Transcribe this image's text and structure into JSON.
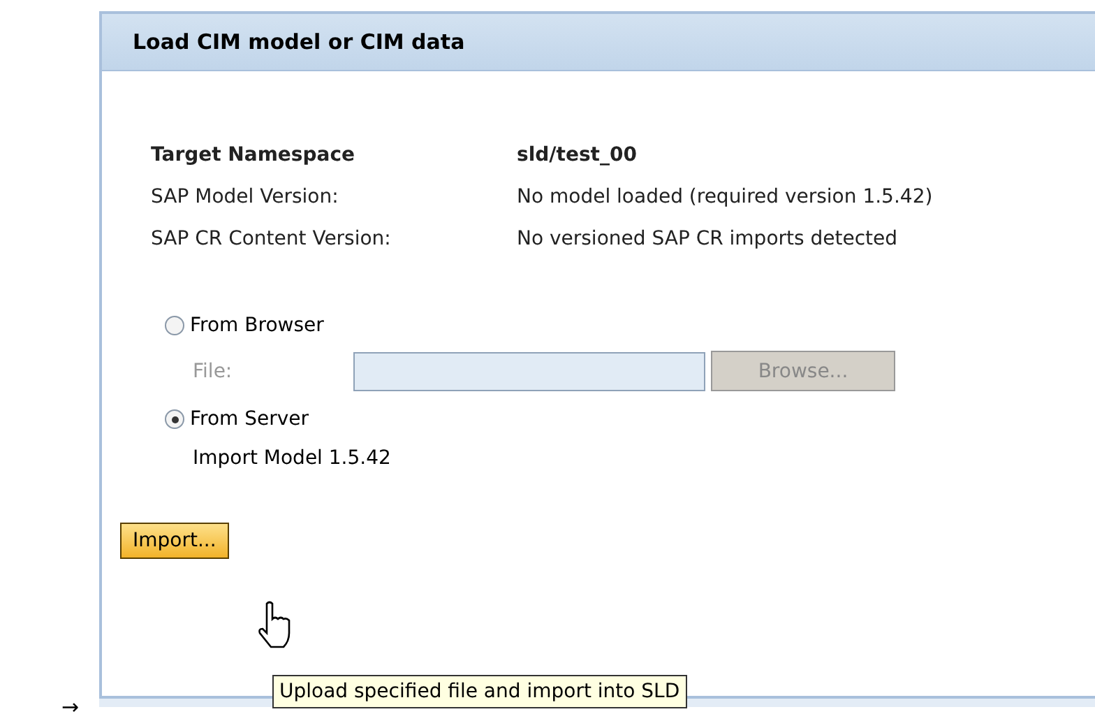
{
  "panel": {
    "title": "Load CIM model or CIM data"
  },
  "info": [
    {
      "label": "Target Namespace",
      "value": "sld/test_00",
      "bold": true
    },
    {
      "label": "SAP Model Version:",
      "value": "No model loaded (required version 1.5.42)",
      "bold": false
    },
    {
      "label": "SAP CR Content Version:",
      "value": "No versioned SAP CR imports detected",
      "bold": false
    }
  ],
  "sources": [
    {
      "label": "From Browser",
      "selected": false
    },
    {
      "label": "From Server",
      "selected": true
    }
  ],
  "file_field": {
    "label": "File:",
    "disabled": true,
    "browse": "Browse..."
  },
  "server_model": "Import Model 1.5.42",
  "import_button": "Import...",
  "tooltip": "Upload specified file and import into SLD",
  "pointer": "→"
}
